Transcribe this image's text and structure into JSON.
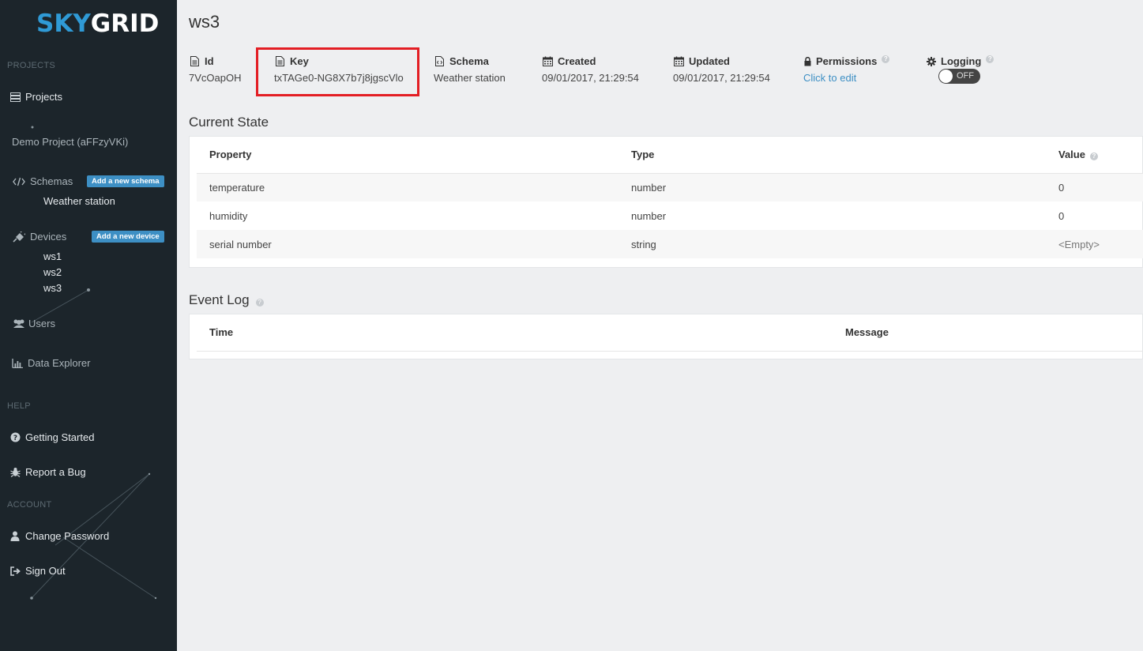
{
  "sidebar": {
    "logo_sky": "SKY",
    "logo_grid": "GRID",
    "projects_header": "PROJECTS",
    "projects_label": "Projects",
    "demo_project": "Demo Project (aFFzyVKi)",
    "schemas_label": "Schemas",
    "add_schema": "Add a new schema",
    "schema_items": [
      "Weather station"
    ],
    "devices_label": "Devices",
    "add_device": "Add a new device",
    "device_items": [
      "ws1",
      "ws2",
      "ws3"
    ],
    "users_label": "Users",
    "data_explorer_label": "Data Explorer",
    "help_header": "HELP",
    "getting_started": "Getting Started",
    "report_bug": "Report a Bug",
    "account_header": "ACCOUNT",
    "change_password": "Change Password",
    "sign_out": "Sign Out"
  },
  "device": {
    "title": "ws3",
    "id_label": "Id",
    "id_value": "7VcOapOH",
    "key_label": "Key",
    "key_value": "txTAGe0-NG8X7b7j8jgscVlo",
    "schema_label": "Schema",
    "schema_value": "Weather station",
    "created_label": "Created",
    "created_value": "09/01/2017, 21:29:54",
    "updated_label": "Updated",
    "updated_value": "09/01/2017, 21:29:54",
    "permissions_label": "Permissions",
    "permissions_value": "Click to edit",
    "logging_label": "Logging",
    "logging_state": "OFF",
    "help_glyph": "?"
  },
  "current_state": {
    "title": "Current State",
    "columns": [
      "Property",
      "Type",
      "Value"
    ],
    "rows": [
      {
        "property": "temperature",
        "type": "number",
        "value": "0"
      },
      {
        "property": "humidity",
        "type": "number",
        "value": "0"
      },
      {
        "property": "serial number",
        "type": "string",
        "value": "<Empty>"
      }
    ]
  },
  "event_log": {
    "title": "Event Log",
    "columns": [
      "Time",
      "Message"
    ]
  },
  "colors": {
    "sidebar_bg": "#1c252b",
    "accent": "#3d8fc4",
    "logo_blue": "#2f9ad6",
    "highlight": "#e31e24"
  }
}
